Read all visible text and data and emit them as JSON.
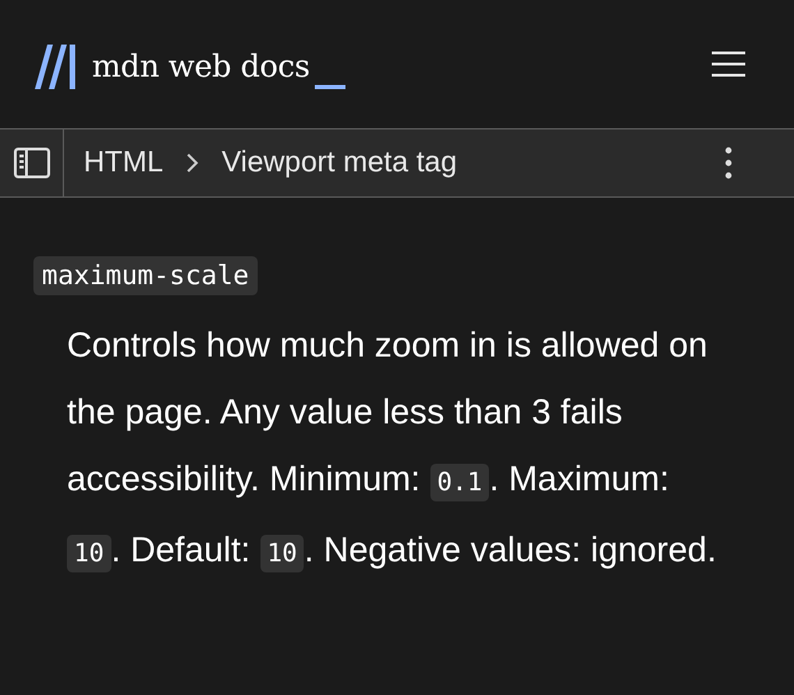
{
  "header": {
    "logo_text": "mdn web docs"
  },
  "breadcrumbs": [
    {
      "label": "HTML"
    },
    {
      "label": "Viewport meta tag"
    }
  ],
  "term": "maximum-scale",
  "description": [
    {
      "kind": "text",
      "text": "Controls how much zoom in is allowed on the page. Any value less than 3 fails accessibility. Minimum: "
    },
    {
      "kind": "code",
      "text": "0.1"
    },
    {
      "kind": "text",
      "text": ". Maximum: "
    },
    {
      "kind": "code",
      "text": "10"
    },
    {
      "kind": "text",
      "text": ". Default: "
    },
    {
      "kind": "code",
      "text": "10"
    },
    {
      "kind": "text",
      "text": ". Negative values: ignored."
    }
  ]
}
